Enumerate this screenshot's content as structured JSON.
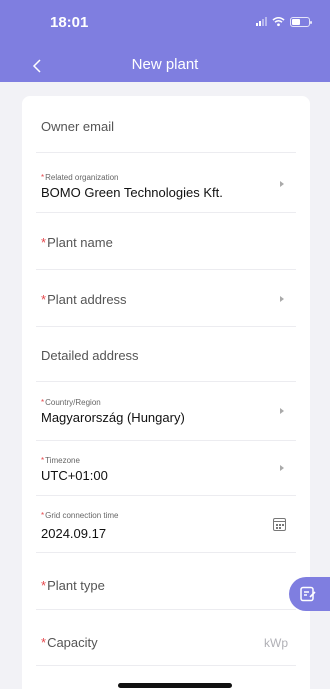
{
  "status_bar": {
    "time": "18:01",
    "battery_level": 0.5
  },
  "header": {
    "title": "New plant",
    "back_icon": "chevron-left-icon"
  },
  "form": {
    "owner_email": {
      "placeholder": "Owner email"
    },
    "related_organization": {
      "label": "Related organization",
      "value": "BOMO Green Technologies Kft.",
      "required": true
    },
    "plant_name": {
      "placeholder": "Plant name",
      "required": true
    },
    "plant_address": {
      "placeholder": "Plant address",
      "required": true
    },
    "detailed_address": {
      "placeholder": "Detailed address"
    },
    "country_region": {
      "label": "Country/Region",
      "value": "Magyarország (Hungary)",
      "required": true
    },
    "timezone": {
      "label": "Timezone",
      "value": "UTC+01:00",
      "required": true
    },
    "grid_connection_time": {
      "label": "Grid connection time",
      "value": "2024.09.17",
      "required": true
    },
    "plant_type": {
      "placeholder": "Plant type",
      "required": true
    },
    "capacity": {
      "placeholder": "Capacity",
      "unit": "kWp",
      "required": true
    }
  },
  "required_marker": "*",
  "colors": {
    "accent": "#7f7ee0",
    "required": "#e5484d",
    "background": "#f2f2f6"
  }
}
